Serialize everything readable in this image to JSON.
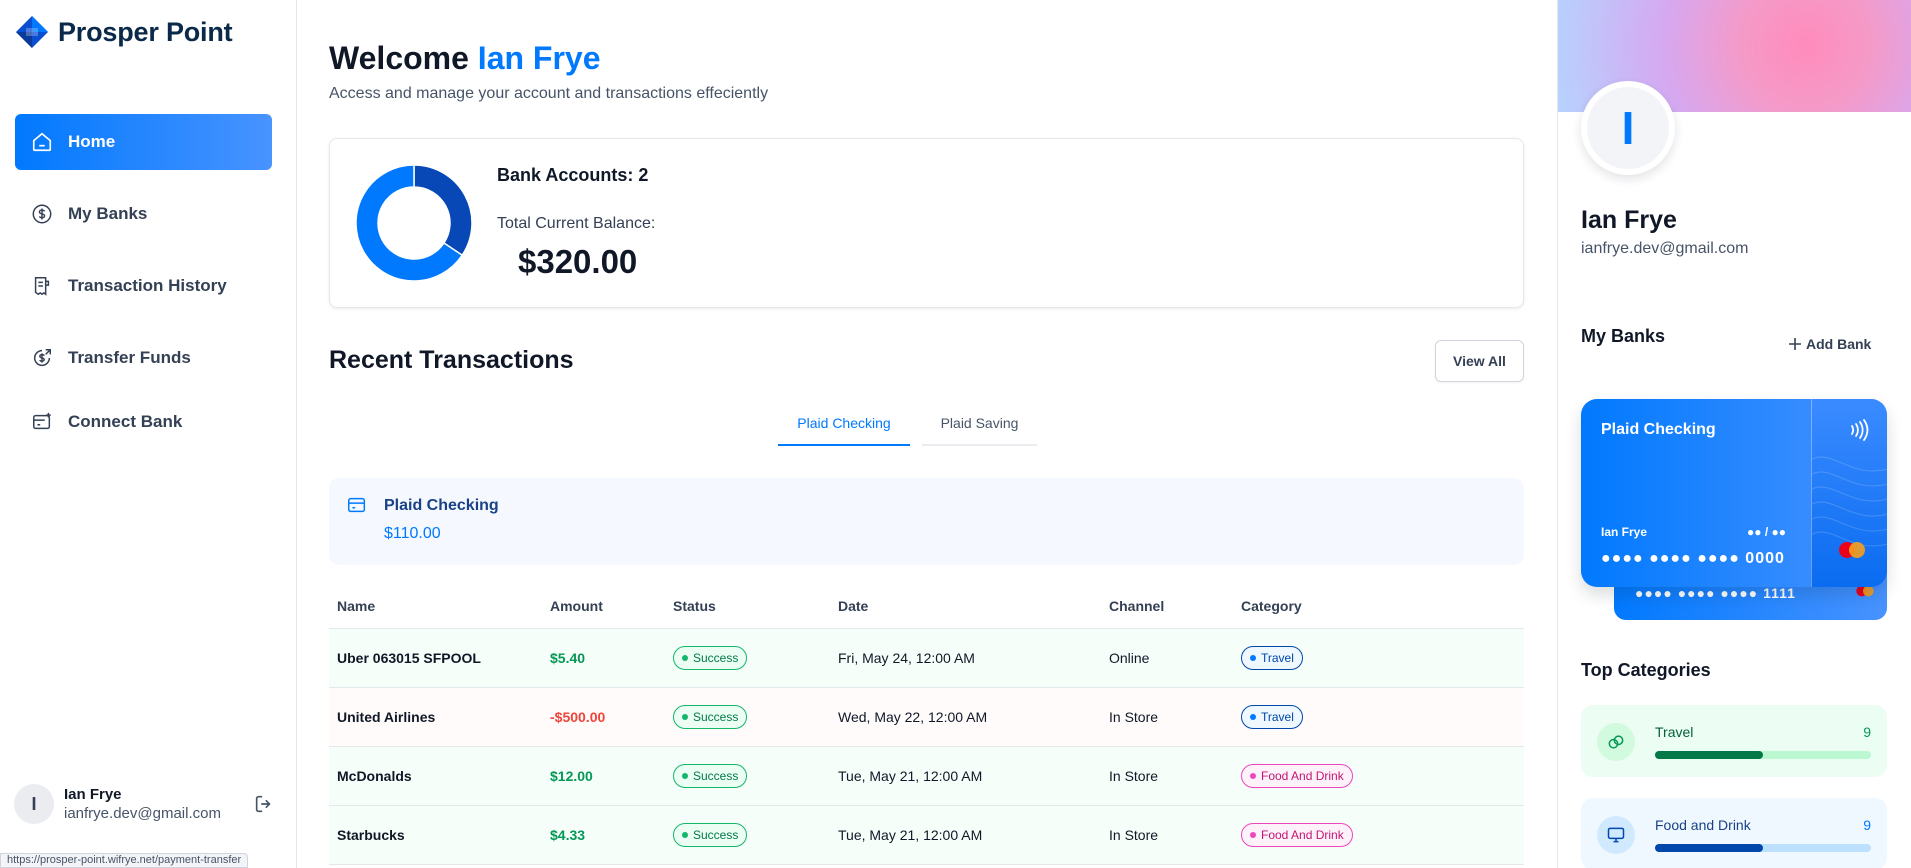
{
  "brand": {
    "name": "Prosper Point"
  },
  "sidebar": {
    "items": [
      {
        "label": "Home",
        "icon": "home-icon",
        "active": true
      },
      {
        "label": "My Banks",
        "icon": "dollar-circle-icon"
      },
      {
        "label": "Transaction History",
        "icon": "receipt-icon"
      },
      {
        "label": "Transfer Funds",
        "icon": "money-send-icon"
      },
      {
        "label": "Connect Bank",
        "icon": "bank-card-add-icon"
      }
    ],
    "user": {
      "initial": "I",
      "name": "Ian Frye",
      "email": "ianfrye.dev@gmail.com"
    }
  },
  "status_url": "https://prosper-point.wifrye.net/payment-transfer",
  "header": {
    "welcome": "Welcome",
    "user_name": "Ian Frye",
    "subtitle": "Access and manage your account and transactions effeciently"
  },
  "balance": {
    "accounts_label": "Bank Accounts: 2",
    "total_label": "Total Current Balance:",
    "total_value": "$320.00",
    "donut": [
      {
        "name": "Plaid Checking",
        "value": 110,
        "color": "#0747b6"
      },
      {
        "name": "Plaid Saving",
        "value": 210,
        "color": "#0179fe"
      }
    ]
  },
  "recent": {
    "title": "Recent Transactions",
    "view_all": "View All",
    "tabs": [
      "Plaid Checking",
      "Plaid Saving"
    ],
    "active_account": {
      "name": "Plaid Checking",
      "balance": "$110.00"
    },
    "columns": [
      "Name",
      "Amount",
      "Status",
      "Date",
      "Channel",
      "Category"
    ],
    "rows": [
      {
        "name": "Uber 063015 SFPOOL",
        "amount": "$5.40",
        "type": "pos",
        "status": "Success",
        "date": "Fri, May 24, 12:00 AM",
        "channel": "Online",
        "category": "Travel",
        "cat_style": "travel"
      },
      {
        "name": "United Airlines",
        "amount": "-$500.00",
        "type": "neg",
        "status": "Success",
        "date": "Wed, May 22, 12:00 AM",
        "channel": "In Store",
        "category": "Travel",
        "cat_style": "travel"
      },
      {
        "name": "McDonalds",
        "amount": "$12.00",
        "type": "pos",
        "status": "Success",
        "date": "Tue, May 21, 12:00 AM",
        "channel": "In Store",
        "category": "Food And Drink",
        "cat_style": "food"
      },
      {
        "name": "Starbucks",
        "amount": "$4.33",
        "type": "pos",
        "status": "Success",
        "date": "Tue, May 21, 12:00 AM",
        "channel": "In Store",
        "category": "Food And Drink",
        "cat_style": "food"
      }
    ]
  },
  "profile": {
    "initial": "I",
    "name": "Ian Frye",
    "email": "ianfrye.dev@gmail.com"
  },
  "my_banks": {
    "title": "My Banks",
    "add_label": "Add Bank",
    "card": {
      "bank": "Plaid Checking",
      "holder": "Ian Frye",
      "expiry": "●● / ●●",
      "number": "●●●● ●●●● ●●●● 0000"
    },
    "back_card": {
      "number": "●●●● ●●●● ●●●● 1111"
    }
  },
  "top_categories": {
    "title": "Top Categories",
    "items": [
      {
        "label": "Travel",
        "count": "9",
        "progress": 0.5
      },
      {
        "label": "Food and Drink",
        "count": "9",
        "progress": 0.5
      }
    ]
  }
}
